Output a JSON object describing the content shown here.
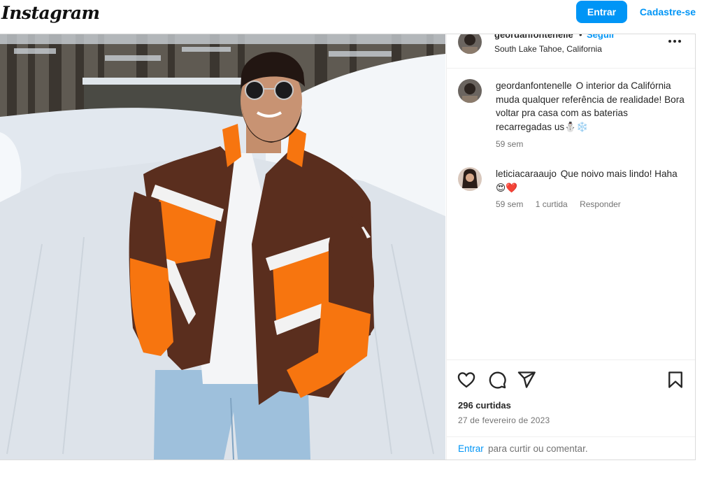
{
  "topbar": {
    "logo": "Instagram",
    "login_label": "Entrar",
    "signup_label": "Cadastre-se"
  },
  "post": {
    "author": {
      "username": "geordanfontenelle",
      "separator": "•",
      "follow_label": "Seguir",
      "location": "South Lake Tahoe, California"
    },
    "comments": [
      {
        "username": "geordanfontenelle",
        "text": "O interior da Califórnia muda qualquer referência de realidade! Bora voltar pra casa com as baterias recarregadas us⛄❄️",
        "time": "59 sem"
      },
      {
        "username": "leticiacaraaujo",
        "text": "Que noivo mais lindo! Haha 😍❤️",
        "time": "59 sem",
        "likes": "1 curtida",
        "reply_label": "Responder"
      }
    ],
    "likes": "296 curtidas",
    "date": "27 de fevereiro de 2023",
    "login_prompt": {
      "link": "Entrar",
      "rest": "para curtir ou comentar."
    }
  },
  "icons": [
    "like-icon",
    "comment-icon",
    "share-icon",
    "save-icon",
    "more-options-icon"
  ],
  "colors": {
    "accent": "#0095f6",
    "jacket_brown": "#5a2e1e",
    "jacket_orange": "#f7750f",
    "snow": "#eef2f6"
  }
}
